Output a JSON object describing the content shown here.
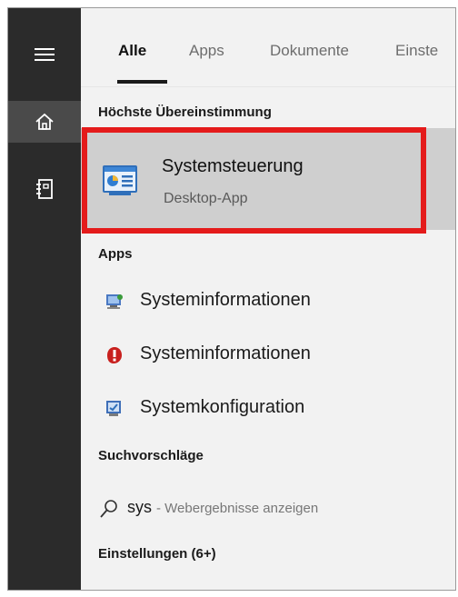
{
  "nav": {
    "menu_icon": "hamburger-menu-icon",
    "home_icon": "home-icon",
    "notebook_icon": "notebook-icon"
  },
  "tabs": [
    {
      "label": "Alle",
      "active": true
    },
    {
      "label": "Apps",
      "active": false
    },
    {
      "label": "Dokumente",
      "active": false
    },
    {
      "label": "Einste",
      "active": false
    }
  ],
  "best_match": {
    "heading": "Höchste Übereinstimmung",
    "title": "Systemsteuerung",
    "subtitle": "Desktop-App",
    "icon": "control-panel-icon",
    "highlight_color": "#e41b1b"
  },
  "apps": {
    "heading": "Apps",
    "items": [
      {
        "label": "Systeminformationen",
        "icon": "system-information-icon"
      },
      {
        "label": "Systeminformationen",
        "icon": "system-information-red-icon"
      },
      {
        "label": "Systemkonfiguration",
        "icon": "system-configuration-icon"
      }
    ]
  },
  "suggestions": {
    "heading": "Suchvorschläge",
    "term": "sys",
    "separator": " - ",
    "hint": "Webergebnisse anzeigen",
    "icon": "search-icon"
  },
  "settings": {
    "heading": "Einstellungen (6+)"
  }
}
